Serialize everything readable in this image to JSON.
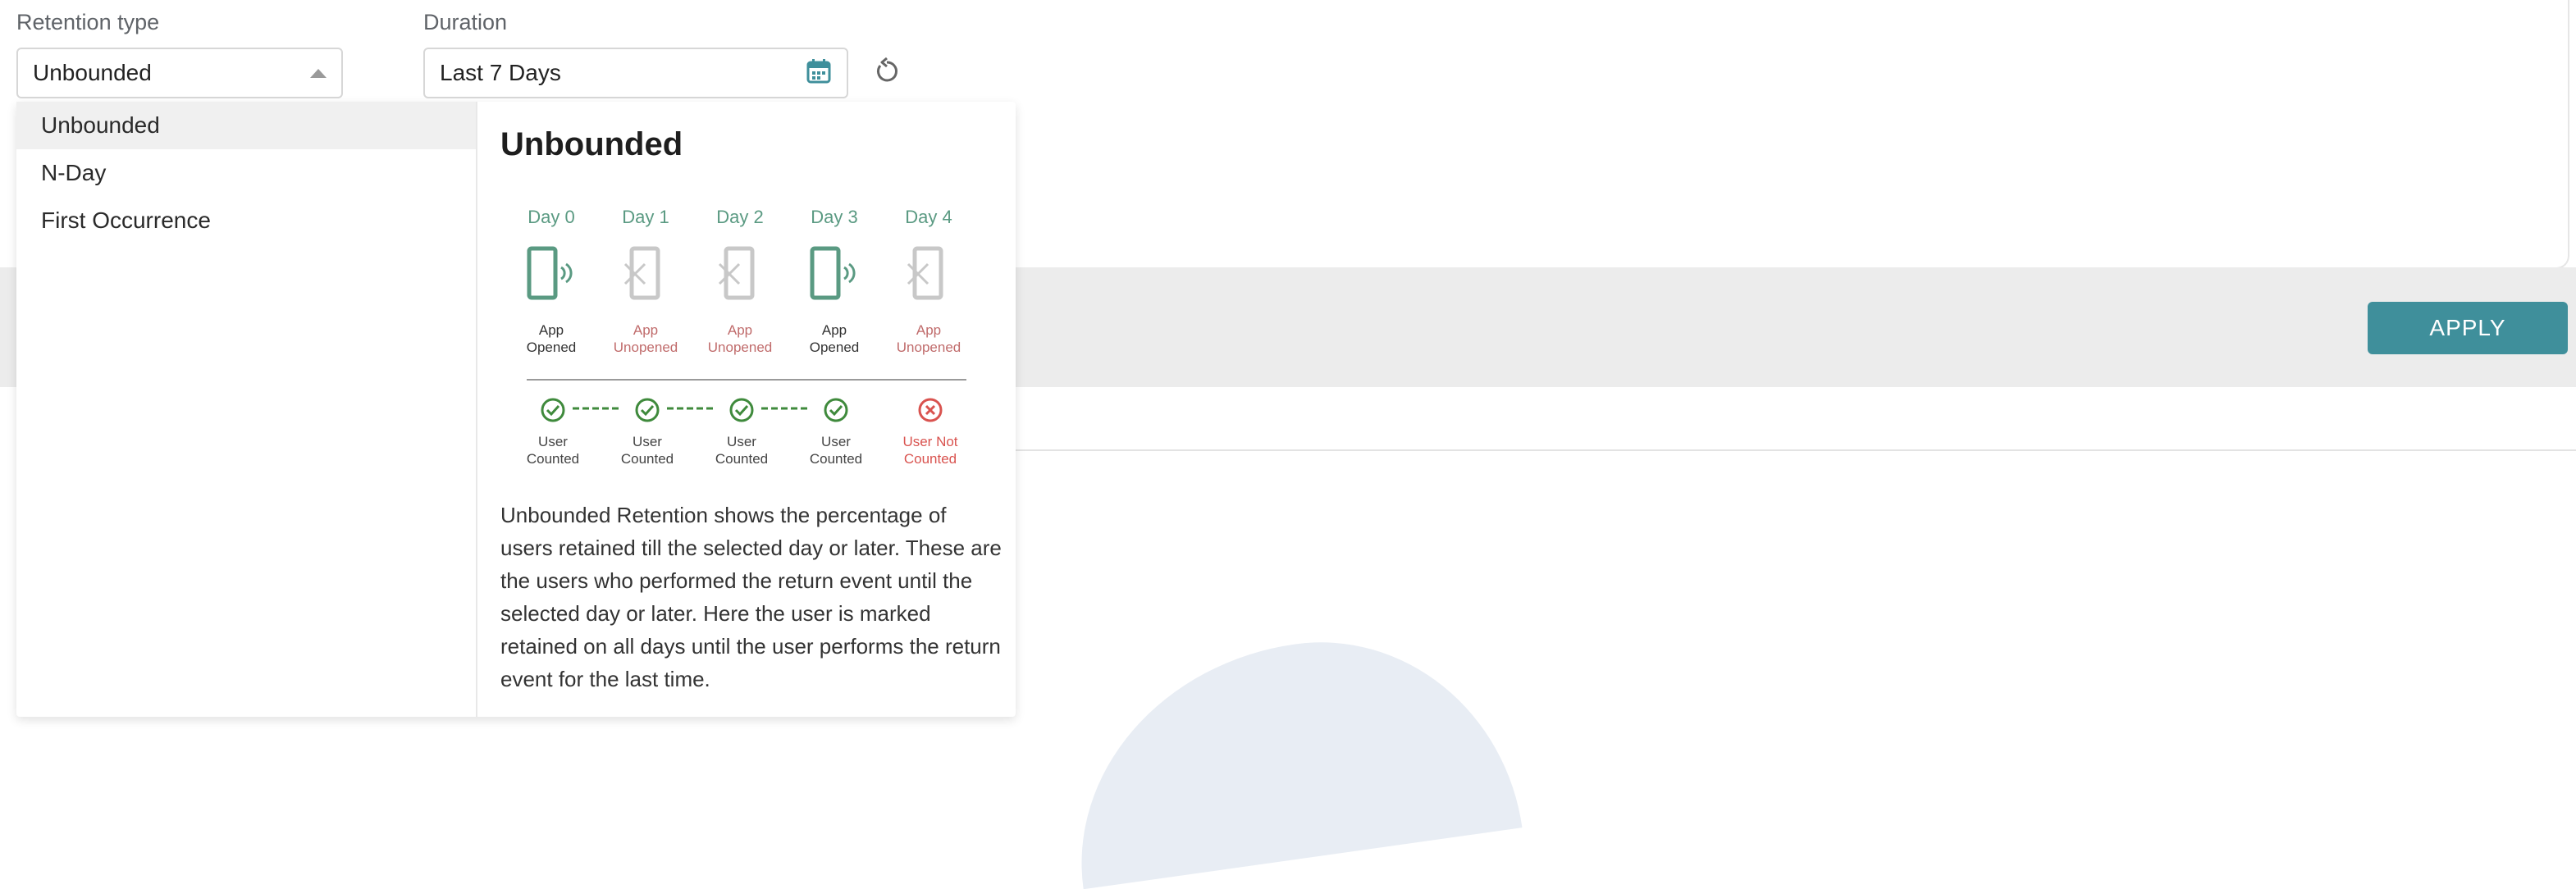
{
  "filters": {
    "retention_label": "Retention type",
    "retention_value": "Unbounded",
    "duration_label": "Duration",
    "duration_value": "Last 7 Days"
  },
  "apply_label": "APPLY",
  "dropdown": {
    "options": [
      "Unbounded",
      "N-Day",
      "First Occurrence"
    ],
    "selected_index": 0
  },
  "preview": {
    "title": "Unbounded",
    "days": [
      "Day 0",
      "Day 1",
      "Day 2",
      "Day 3",
      "Day 4"
    ],
    "events": [
      {
        "line1": "App",
        "line2": "Opened",
        "state": "opened"
      },
      {
        "line1": "App",
        "line2": "Unopened",
        "state": "unopened"
      },
      {
        "line1": "App",
        "line2": "Unopened",
        "state": "unopened"
      },
      {
        "line1": "App",
        "line2": "Opened",
        "state": "opened"
      },
      {
        "line1": "App",
        "line2": "Unopened",
        "state": "unopened"
      }
    ],
    "counted": [
      {
        "line1": "User",
        "line2": "Counted",
        "state": "yes"
      },
      {
        "line1": "User",
        "line2": "Counted",
        "state": "yes"
      },
      {
        "line1": "User",
        "line2": "Counted",
        "state": "yes"
      },
      {
        "line1": "User",
        "line2": "Counted",
        "state": "yes"
      },
      {
        "line1": "User Not",
        "line2": "Counted",
        "state": "no"
      }
    ],
    "description": "Unbounded Retention shows the percentage of users retained till the selected day or later. These are the users who performed the return event until the selected day or later. Here the user is marked retained on all days until the user performs the return event for the last time."
  },
  "icons": {
    "select_caret": "caret-up-icon",
    "calendar": "calendar-icon",
    "reset": "reset-icon",
    "phone_opened": "phone-opened-icon",
    "phone_unopened": "phone-unopened-icon",
    "check": "check-circle-icon",
    "cross": "cross-circle-icon"
  },
  "colors": {
    "accent": "#3f8f9b",
    "green": "#5a9a82",
    "unopened_text": "#c06b6b",
    "not_counted": "#d9534f",
    "grey_icon": "#c8c8c8"
  }
}
